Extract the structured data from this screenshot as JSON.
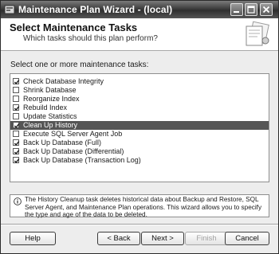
{
  "window": {
    "title": "Maintenance Plan Wizard - (local)",
    "icons": {
      "app": "wizard-app-icon",
      "minimize": "minimize-icon",
      "maximize": "maximize-icon",
      "close": "close-icon"
    }
  },
  "header": {
    "title": "Select Maintenance Tasks",
    "subtitle": "Which tasks should this plan perform?",
    "graphic": "wizard-graphic"
  },
  "prompt": "Select one or more maintenance tasks:",
  "tasks": [
    {
      "label": "Check Database Integrity",
      "checked": true,
      "selected": false
    },
    {
      "label": "Shrink Database",
      "checked": false,
      "selected": false
    },
    {
      "label": "Reorganize Index",
      "checked": false,
      "selected": false
    },
    {
      "label": "Rebuild Index",
      "checked": true,
      "selected": false
    },
    {
      "label": "Update Statistics",
      "checked": false,
      "selected": false
    },
    {
      "label": "Clean Up History",
      "checked": true,
      "selected": true
    },
    {
      "label": "Execute SQL Server Agent Job",
      "checked": false,
      "selected": false
    },
    {
      "label": "Back Up Database (Full)",
      "checked": true,
      "selected": false
    },
    {
      "label": "Back Up Database (Differential)",
      "checked": true,
      "selected": false
    },
    {
      "label": "Back Up Database (Transaction Log)",
      "checked": true,
      "selected": false
    }
  ],
  "info": {
    "icon": "info-icon",
    "text": "The History Cleanup task deletes historical data about Backup and Restore, SQL Server Agent, and Maintenance Plan operations. This wizard allows you to specify the type and age of the data to be deleted."
  },
  "buttons": {
    "help": "Help",
    "back": "< Back",
    "next": "Next >",
    "finish": "Finish",
    "cancel": "Cancel"
  }
}
